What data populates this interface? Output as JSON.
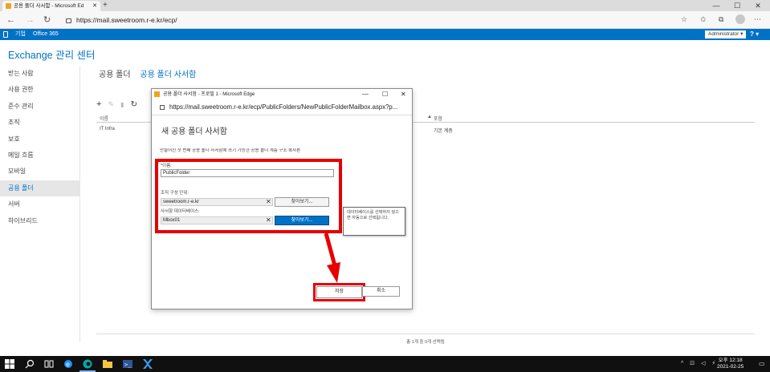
{
  "browser": {
    "tab_title": "공용 폴더 사서함 - Microsoft Ed",
    "url": "https://mail.sweetroom.r-e.kr/ecp/"
  },
  "o365": {
    "brand": "기업",
    "suite": "Office 365",
    "user": "Administrator ▾",
    "help": "? ▾"
  },
  "eac": {
    "title": "Exchange 관리 센터",
    "nav": [
      "받는 사람",
      "사용 권한",
      "준수 관리",
      "조직",
      "보호",
      "메일 흐름",
      "모바일",
      "공용 폴더",
      "서버",
      "하이브리드"
    ],
    "subnav_current": "공용 폴더",
    "subnav_link": "공용 폴더 사서함",
    "grid_col_name": "이름",
    "grid_col_contains": "포함",
    "grid_sort_marker": "▲",
    "row_name": "IT Infra",
    "row_contains": "기본 계층",
    "footer": "총 1개 중 0개 선택됨"
  },
  "dialog": {
    "window_title": "공용 폴더 사서함 - 프로필 1 - Microsoft Edge",
    "url": "https://mail.sweetroom.r-e.kr/ecp/PublicFolders/NewPublicFolderMailbox.aspx?p...",
    "heading": "새 공용 폴더 사서함",
    "description": "만들어진 첫 번째 공용 폴더 사서함에 쓰기 가능한 공용 폴더 계층 구조 복사본",
    "name_label": "*이름:",
    "name_value": "PublicFolder",
    "ou_label": "조직 구성 단위:",
    "ou_value": "sweetroom.r-e.kr",
    "db_label": "사서함 데이터베이스:",
    "db_value": "Mbox01",
    "browse": "찾아보기...",
    "tooltip": "데이터베이스를 선택하지 않으면 자동으로 선택됩니다.",
    "save": "저장",
    "cancel": "취소"
  },
  "taskbar": {
    "time": "오후 12:18",
    "date": "2021-02-25"
  },
  "colors": {
    "accent": "#0072c6",
    "highlight": "#e60000"
  }
}
